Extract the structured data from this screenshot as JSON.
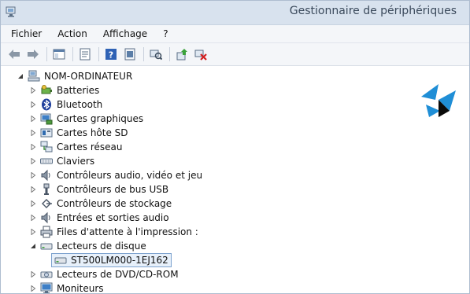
{
  "window": {
    "title": "Gestionnaire de périphériques"
  },
  "menu": [
    "Fichier",
    "Action",
    "Affichage",
    "?"
  ],
  "toolbar": [
    "back",
    "forward",
    "console-tree",
    "properties",
    "help",
    "scan-hardware",
    "update-driver",
    "uninstall"
  ],
  "tree": {
    "root": "NOM-ORDINATEUR",
    "items": [
      {
        "label": "Batteries",
        "icon": "battery-icon",
        "expanded": false
      },
      {
        "label": "Bluetooth",
        "icon": "bluetooth-icon",
        "expanded": false
      },
      {
        "label": "Cartes graphiques",
        "icon": "display-adapter-icon",
        "expanded": false
      },
      {
        "label": "Cartes hôte SD",
        "icon": "sd-card-icon",
        "expanded": false
      },
      {
        "label": "Cartes réseau",
        "icon": "network-icon",
        "expanded": false
      },
      {
        "label": "Claviers",
        "icon": "keyboard-icon",
        "expanded": false
      },
      {
        "label": "Contrôleurs audio, vidéo et jeu",
        "icon": "speaker-icon",
        "expanded": false
      },
      {
        "label": "Contrôleurs de bus USB",
        "icon": "usb-icon",
        "expanded": false
      },
      {
        "label": "Contrôleurs de stockage",
        "icon": "storage-controller-icon",
        "expanded": false
      },
      {
        "label": "Entrées et sorties audio",
        "icon": "speaker-icon",
        "expanded": false
      },
      {
        "label": "Files d'attente à l'impression :",
        "icon": "printer-icon",
        "expanded": false
      },
      {
        "label": "Lecteurs de disque",
        "icon": "disk-drive-icon",
        "expanded": true,
        "children": [
          "ST500LM000-1EJ162"
        ]
      },
      {
        "label": "Lecteurs de DVD/CD-ROM",
        "icon": "dvd-icon",
        "expanded": false
      },
      {
        "label": "Moniteurs",
        "icon": "monitor-icon",
        "expanded": false
      }
    ]
  },
  "colors": {
    "titlebar": "#d8e2ee",
    "selection_border": "#7da2ce",
    "selection_fill": "#e7f0fa"
  }
}
